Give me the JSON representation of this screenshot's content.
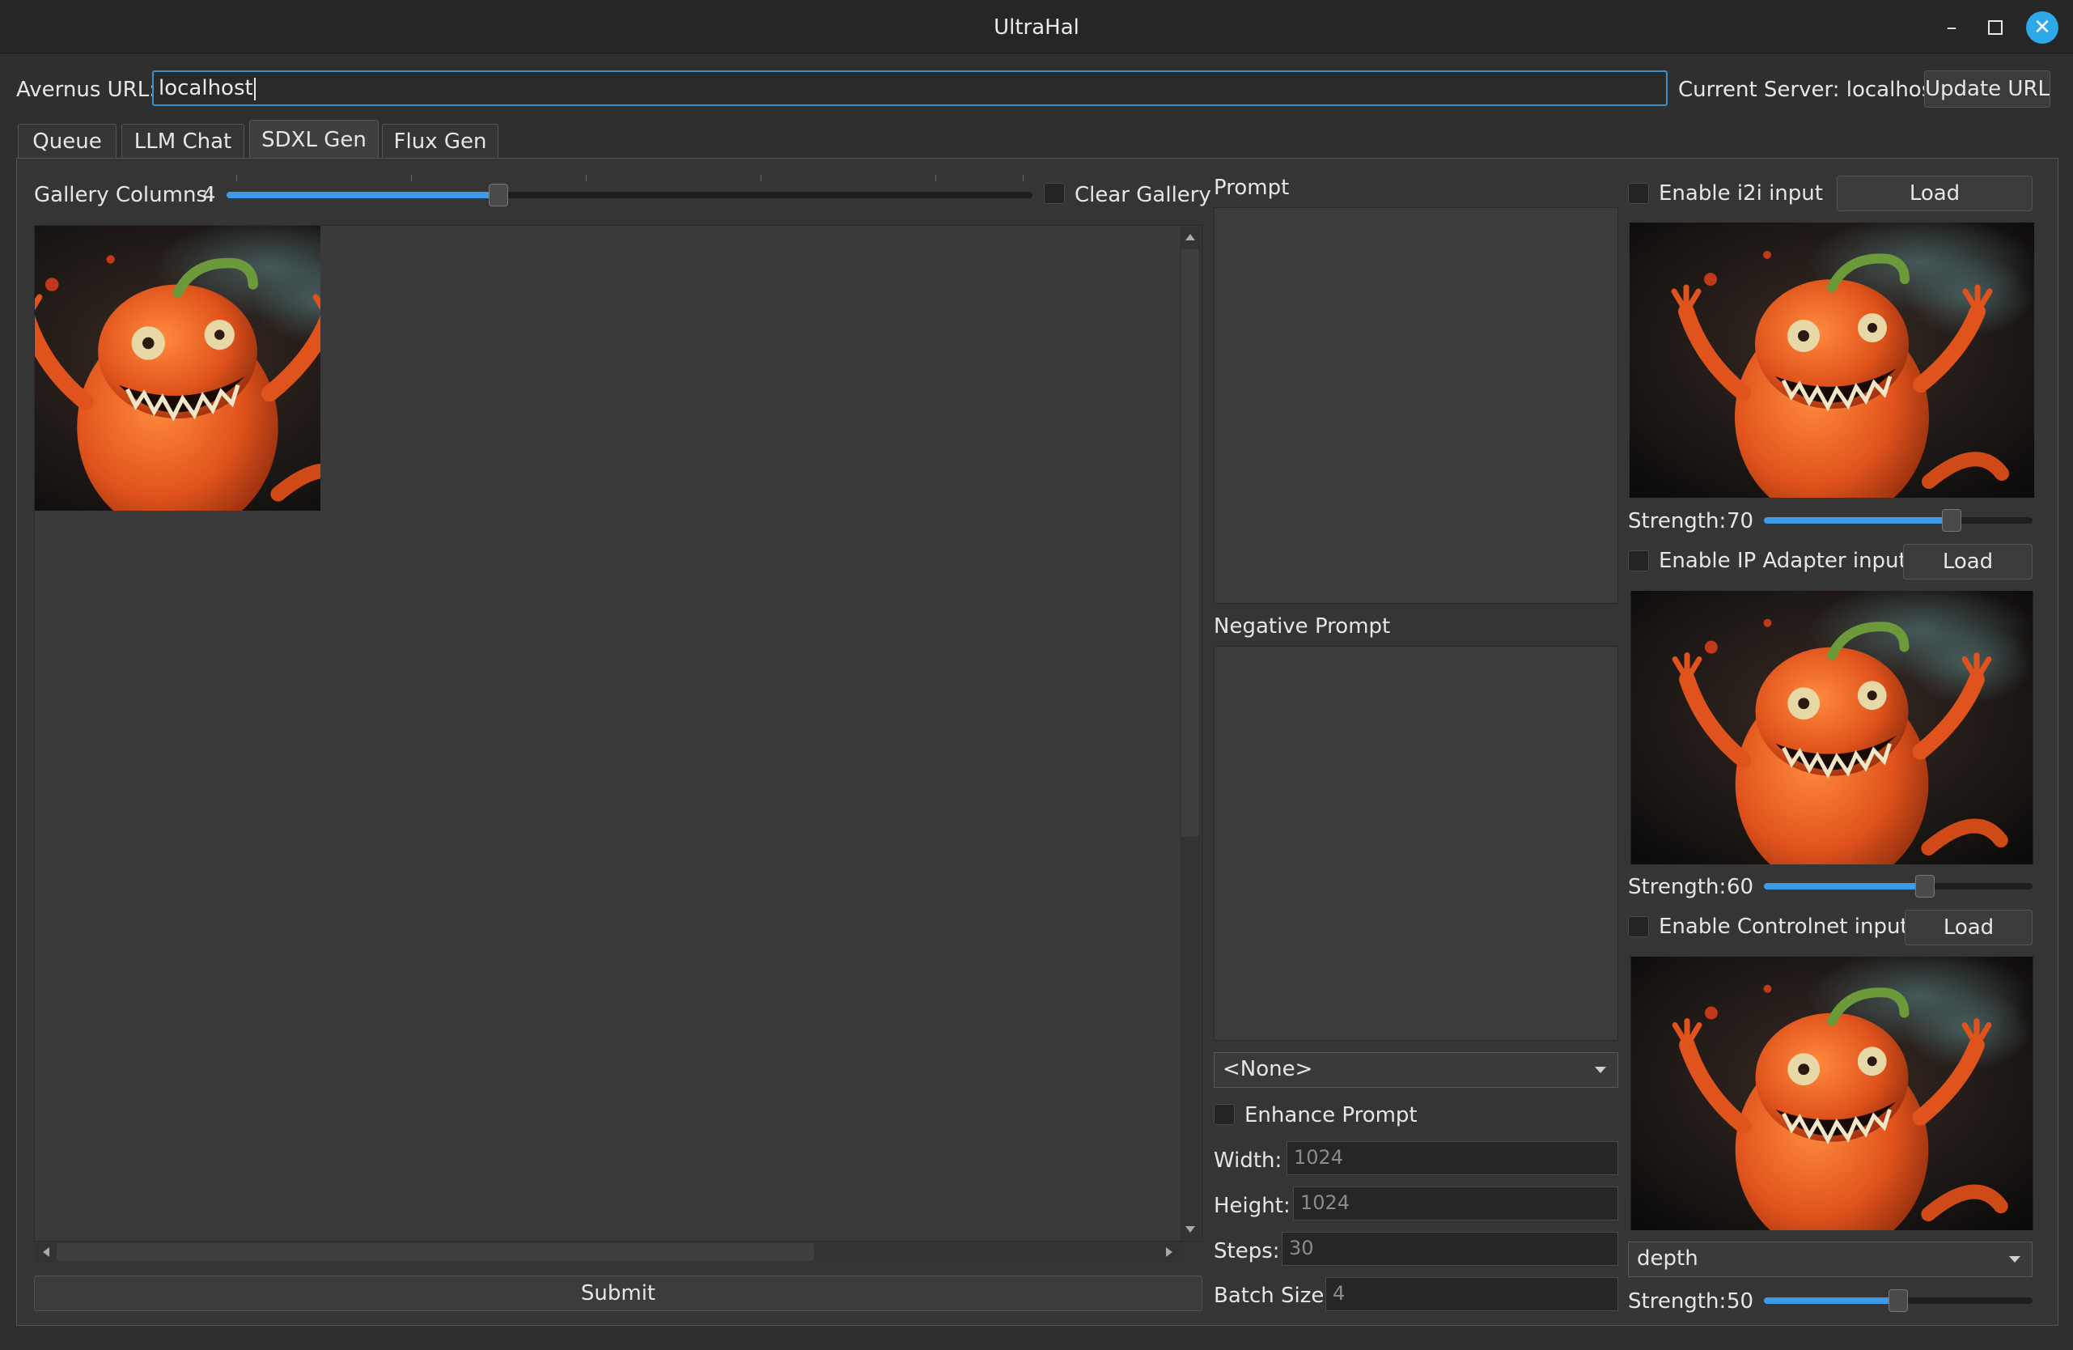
{
  "window": {
    "title": "UltraHal"
  },
  "url_bar": {
    "label": "Avernus URL:",
    "value": "localhost",
    "current_server": "Current Server: localhost",
    "update_label": "Update URL"
  },
  "tabs": [
    {
      "label": "Queue",
      "active": false
    },
    {
      "label": "LLM Chat",
      "active": false
    },
    {
      "label": "SDXL Gen",
      "active": true
    },
    {
      "label": "Flux Gen",
      "active": false
    }
  ],
  "gallery": {
    "columns_label": "Gallery Columns:",
    "columns_value": "4",
    "clear_label": "Clear Gallery",
    "submit_label": "Submit",
    "slider_fraction": 0.33
  },
  "prompt": {
    "label": "Prompt",
    "value": ""
  },
  "negative_prompt": {
    "label": "Negative Prompt",
    "value": ""
  },
  "style_select": {
    "selected": "<None>"
  },
  "enhance": {
    "label": "Enhance Prompt"
  },
  "params": {
    "width_label": "Width:",
    "width": "1024",
    "height_label": "Height:",
    "height": "1024",
    "steps_label": "Steps:",
    "steps": "30",
    "batch_label": "Batch Size:",
    "batch": "4"
  },
  "i2i": {
    "enable_label": "Enable i2i input",
    "load_label": "Load",
    "strength_label": "Strength:",
    "strength": "70",
    "strength_fraction": 0.7
  },
  "ip_adapter": {
    "enable_label": "Enable IP Adapter input",
    "load_label": "Load",
    "strength_label": "Strength:",
    "strength": "60",
    "strength_fraction": 0.6
  },
  "controlnet": {
    "enable_label": "Enable Controlnet input",
    "load_label": "Load",
    "type_selected": "depth",
    "strength_label": "Strength:",
    "strength": "50",
    "strength_fraction": 0.5
  },
  "icons": {
    "minimize": "minimize-icon",
    "maximize": "maximize-icon",
    "close": "close-icon",
    "dropdown": "chevron-down-icon"
  },
  "colors": {
    "accent": "#3d9be9",
    "close_button": "#2da8e8",
    "background": "#2f2f2f"
  }
}
